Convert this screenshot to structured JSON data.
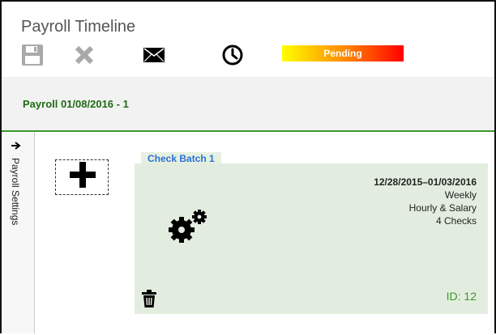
{
  "app": {
    "title": "Payroll Timeline"
  },
  "toolbar": {
    "buttons": [
      {
        "name": "save",
        "icon": "floppy-disk-icon"
      },
      {
        "name": "delete",
        "icon": "close-x-icon"
      },
      {
        "name": "email",
        "icon": "envelope-icon"
      },
      {
        "name": "history",
        "icon": "clock-icon"
      }
    ],
    "status": {
      "label": "Pending",
      "gradient_colors": [
        "#ffff00",
        "#ff8c00",
        "#ff0000"
      ]
    }
  },
  "payroll": {
    "title": "Payroll 01/08/2016 - 1",
    "accent_color": "#3a9a2a"
  },
  "side_panel": {
    "label": "Payroll Settings",
    "icon": "arrow-right-icon"
  },
  "add_batch": {
    "icon": "plus-icon"
  },
  "batch": {
    "tab_label": "Check Batch 1",
    "date_range": "12/28/2015–01/03/2016",
    "frequency": "Weekly",
    "pay_type": "Hourly & Salary",
    "check_count": "4 Checks",
    "id_label": "ID: 12",
    "icons": [
      "gears-icon",
      "trash-icon"
    ]
  }
}
